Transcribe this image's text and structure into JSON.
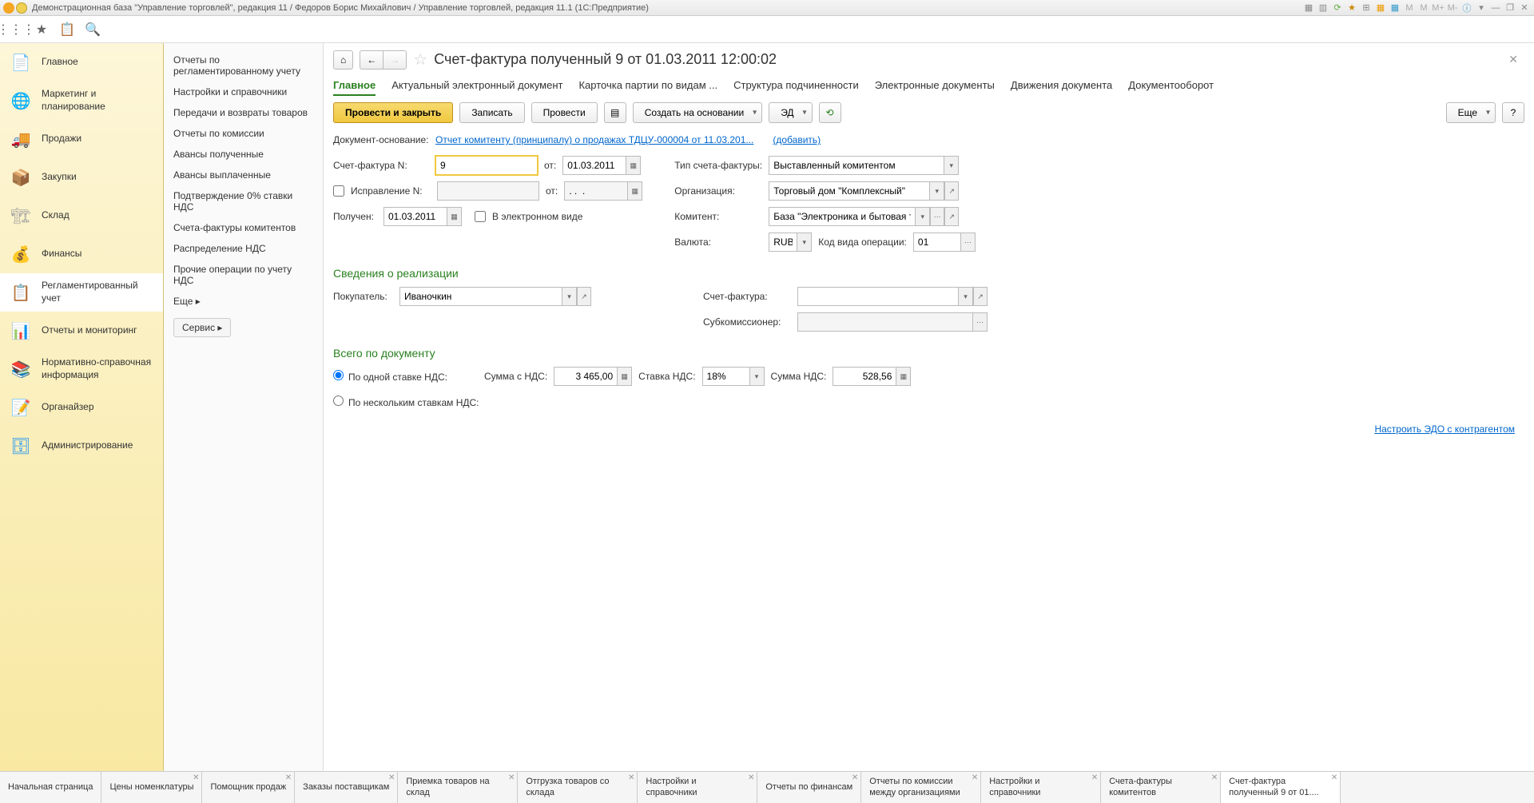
{
  "titleBar": {
    "text": "Демонстрационная база \"Управление торговлей\", редакция 11 / Федоров Борис Михайлович / Управление торговлей, редакция 11.1  (1С:Предприятие)"
  },
  "nav": {
    "items": [
      {
        "label": "Главное",
        "icon": "📄",
        "color": "#8bc34a"
      },
      {
        "label": "Маркетинг и планирование",
        "icon": "🌐",
        "color": "#4caf50"
      },
      {
        "label": "Продажи",
        "icon": "🚚",
        "color": "#ff9800"
      },
      {
        "label": "Закупки",
        "icon": "📦",
        "color": "#795548"
      },
      {
        "label": "Склад",
        "icon": "🏗",
        "color": "#9e9e9e"
      },
      {
        "label": "Финансы",
        "icon": "💰",
        "color": "#ffc107"
      },
      {
        "label": "Регламентированный учет",
        "icon": "📋",
        "color": "#ff5722",
        "active": true
      },
      {
        "label": "Отчеты и мониторинг",
        "icon": "📊",
        "color": "#4caf50"
      },
      {
        "label": "Нормативно-справочная информация",
        "icon": "📚",
        "color": "#8bc34a"
      },
      {
        "label": "Органайзер",
        "icon": "📝",
        "color": "#03a9f4"
      },
      {
        "label": "Администрирование",
        "icon": "🗄",
        "color": "#2196f3"
      }
    ]
  },
  "subnav": {
    "items": [
      "Отчеты по регламентированному учету",
      "Настройки и справочники",
      "Передачи и возвраты товаров",
      "Отчеты по комиссии",
      "Авансы полученные",
      "Авансы выплаченные",
      "Подтверждение 0% ставки НДС",
      "Счета-фактуры комитентов",
      "Распределение НДС",
      "Прочие операции по учету НДС"
    ],
    "more": "Еще ▸",
    "service": "Сервис ▸"
  },
  "doc": {
    "title": "Счет-фактура полученный 9 от 01.03.2011 12:00:02",
    "tabs": [
      {
        "label": "Главное",
        "active": true
      },
      {
        "label": "Актуальный электронный документ"
      },
      {
        "label": "Карточка партии по видам ..."
      },
      {
        "label": "Структура подчиненности"
      },
      {
        "label": "Электронные документы"
      },
      {
        "label": "Движения документа"
      },
      {
        "label": "Документооборот"
      }
    ],
    "actions": {
      "post_close": "Провести и закрыть",
      "save": "Записать",
      "post": "Провести",
      "create_based": "Создать на основании",
      "ed": "ЭД",
      "more": "Еще",
      "help": "?"
    },
    "fields": {
      "basis_label": "Документ-основание:",
      "basis_link": "Отчет комитенту (принципалу) о продажах ТДЦУ-000004 от 11.03.201...",
      "basis_add": "(добавить)",
      "invoice_no_label": "Счет-фактура N:",
      "invoice_no_value": "9",
      "from_label": "от:",
      "from_date": "01.03.2011",
      "type_label": "Тип счета-фактуры:",
      "type_value": "Выставленный комитентом",
      "correction_label": "Исправление N:",
      "correction_from": "от:",
      "correction_date": ". .  .",
      "org_label": "Организация:",
      "org_value": "Торговый дом \"Комплексный\"",
      "received_label": "Получен:",
      "received_date": "01.03.2011",
      "electronic_label": "В электронном виде",
      "komitent_label": "Комитент:",
      "komitent_value": "База \"Электроника и бытовая техника\"",
      "currency_label": "Валюта:",
      "currency_value": "RUB",
      "op_code_label": "Код вида операции:",
      "op_code_value": "01",
      "section_sales": "Сведения о реализации",
      "buyer_label": "Покупатель:",
      "buyer_value": "Иваночкин",
      "invoice_ref_label": "Счет-фактура:",
      "subcom_label": "Субкомиссионер:",
      "section_totals": "Всего по документу",
      "single_rate": "По одной ставке НДС:",
      "multi_rate": "По нескольким ставкам НДС:",
      "sum_vat_label": "Сумма с НДС:",
      "sum_vat_value": "3 465,00",
      "vat_rate_label": "Ставка НДС:",
      "vat_rate_value": "18%",
      "vat_sum_label": "Сумма НДС:",
      "vat_sum_value": "528,56",
      "settings_link": "Настроить ЭДО с контрагентом"
    }
  },
  "bottomTabs": [
    {
      "label": "Начальная страница"
    },
    {
      "label": "Цены номенклатуры",
      "close": true
    },
    {
      "label": "Помощник продаж",
      "close": true
    },
    {
      "label": "Заказы поставщикам",
      "close": true
    },
    {
      "label": "Приемка товаров на склад",
      "close": true
    },
    {
      "label": "Отгрузка товаров со склада",
      "close": true
    },
    {
      "label": "Настройки и справочники",
      "close": true
    },
    {
      "label": "Отчеты по финансам",
      "close": true
    },
    {
      "label": "Отчеты по комиссии между организациями",
      "close": true
    },
    {
      "label": "Настройки и справочники",
      "close": true
    },
    {
      "label": "Счета-фактуры комитентов",
      "close": true
    },
    {
      "label": "Счет-фактура полученный 9 от 01....",
      "close": true,
      "active": true
    }
  ]
}
